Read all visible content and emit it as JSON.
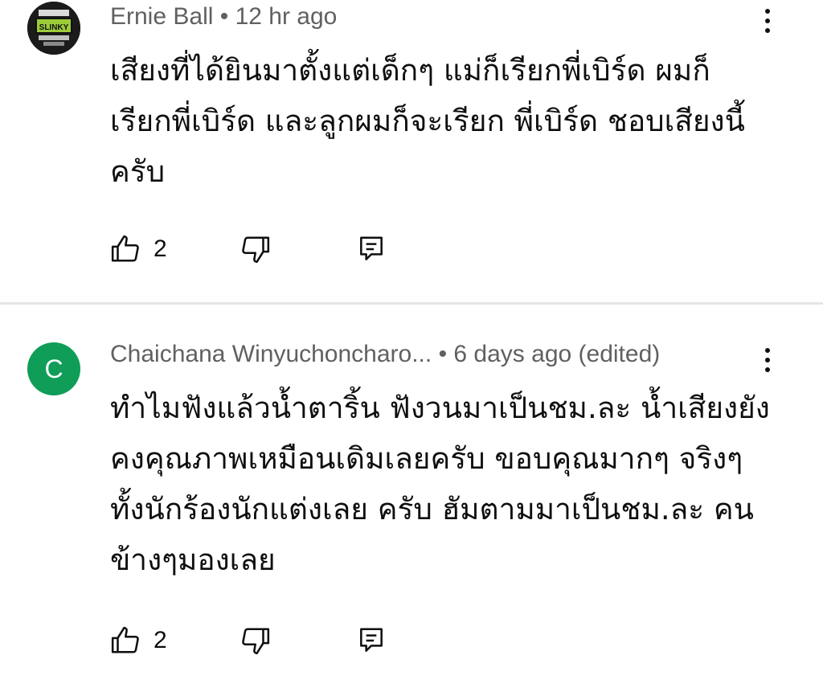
{
  "comments": [
    {
      "author": "Ernie Ball",
      "time": " • 12 hr ago",
      "text": "เสียงที่ได้ยินมาตั้งแต่เด็กๆ แม่ก็เรียกพี่เบิร์ด ผมก็\nเรียกพี่เบิร์ด และลูกผมก็จะเรียก พี่เบิร์ด ชอบเสียงนี้\nครับ",
      "likes": "2",
      "avatar_label": "SLINKY"
    },
    {
      "author": "Chaichana Winyuchoncharo...",
      "time": " • 6 days ago (edited)",
      "text": "ทำไมฟังแล้วน้ำตาริ้น ฟังวนมาเป็นชม.ละ น้ำเสียงยัง\nคงคุณภาพเหมือนเดิมเลยครับ ขอบคุณมากๆ จริงๆ\nทั้งนักร้องนักแต่งเลย ครับ ฮัมตามมาเป็นชม.ละ คน\nข้างๆมองเลย",
      "likes": "2",
      "avatar_letter": "C"
    }
  ],
  "colors": {
    "avatar_green": "#0f9d58",
    "meta_gray": "#606060",
    "divider": "#e5e5e5"
  },
  "icons": {
    "like": "thumb-up-icon",
    "dislike": "thumb-down-icon",
    "reply": "reply-comment-icon",
    "menu": "more-vertical-icon"
  }
}
